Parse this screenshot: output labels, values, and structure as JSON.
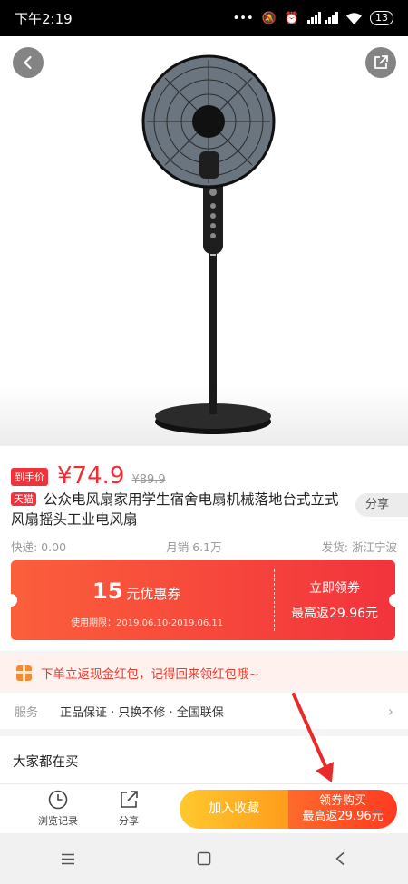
{
  "status_bar": {
    "time": "下午2:19",
    "battery": "13"
  },
  "product": {
    "price_tag": "到手价",
    "price": "¥74.9",
    "original_price": "¥89.9",
    "platform_tag": "天猫",
    "title": "公众电风扇家用学生宿舍电扇机械落地台式立式风扇摇头工业电风扇",
    "share_label": "分享",
    "shipping": "快递: 0.00",
    "monthly_sales": "月销 6.1万",
    "origin": "发货: 浙江宁波"
  },
  "coupon": {
    "amount": "15",
    "text": "元优惠券",
    "period": "使用期限：2019.06.10-2019.06.11",
    "get_label": "立即领券",
    "rebate": "最高返29.96元"
  },
  "notice": {
    "text": "下单立返现金红包，记得回来领红包哦~"
  },
  "service": {
    "label": "服务",
    "text": "正品保证 · 只换不修 · 全国联保"
  },
  "section": {
    "everyone_buying": "大家都在买"
  },
  "bottom_bar": {
    "history_label": "浏览记录",
    "share_label": "分享",
    "favorite_label": "加入收藏",
    "buy_label": "领券购买",
    "buy_rebate": "最高返29.96元"
  },
  "colors": {
    "accent": "#ef2d32",
    "coupon": "#f2333c",
    "favorite": "#ffb020",
    "buy": "#ff4a25"
  },
  "icons": {
    "back": "chevron-left-icon",
    "share": "share-out-icon",
    "history": "clock-icon",
    "nav_menu": "menu-icon",
    "nav_home": "square-icon",
    "nav_back": "back-triangle-icon"
  }
}
